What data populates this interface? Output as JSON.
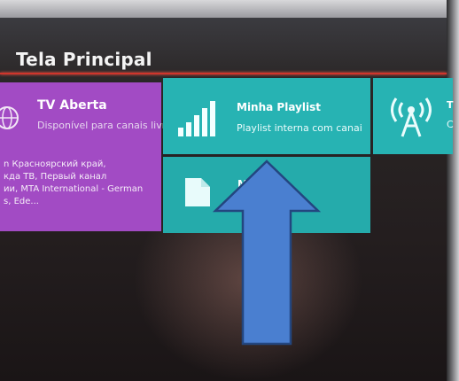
{
  "header": {
    "title": "Tela Principal"
  },
  "tiles": {
    "tv": {
      "title": "TV Aberta",
      "subtitle": "Disponível para canais livr",
      "body_lines": [
        "n Красноярский край,",
        "кда ТВ, Первый канал",
        "ии, MTA International - German",
        "s, Ede..."
      ]
    },
    "playlist": {
      "title": "Minha Playlist",
      "subtitle": "Playlist interna com canai"
    },
    "second": {
      "title": "M"
    },
    "third": {
      "title": "T",
      "subtitle": "C"
    }
  },
  "icons": {
    "globe": "globe-icon",
    "bars": "signal-bars-icon",
    "doc": "document-icon",
    "antenna": "antenna-icon"
  },
  "colors": {
    "tv_tile": "#a24bc4",
    "playlist_tile": "#27b3b3",
    "accent_line": "#d0352c",
    "arrow": "#4a7fd0"
  }
}
